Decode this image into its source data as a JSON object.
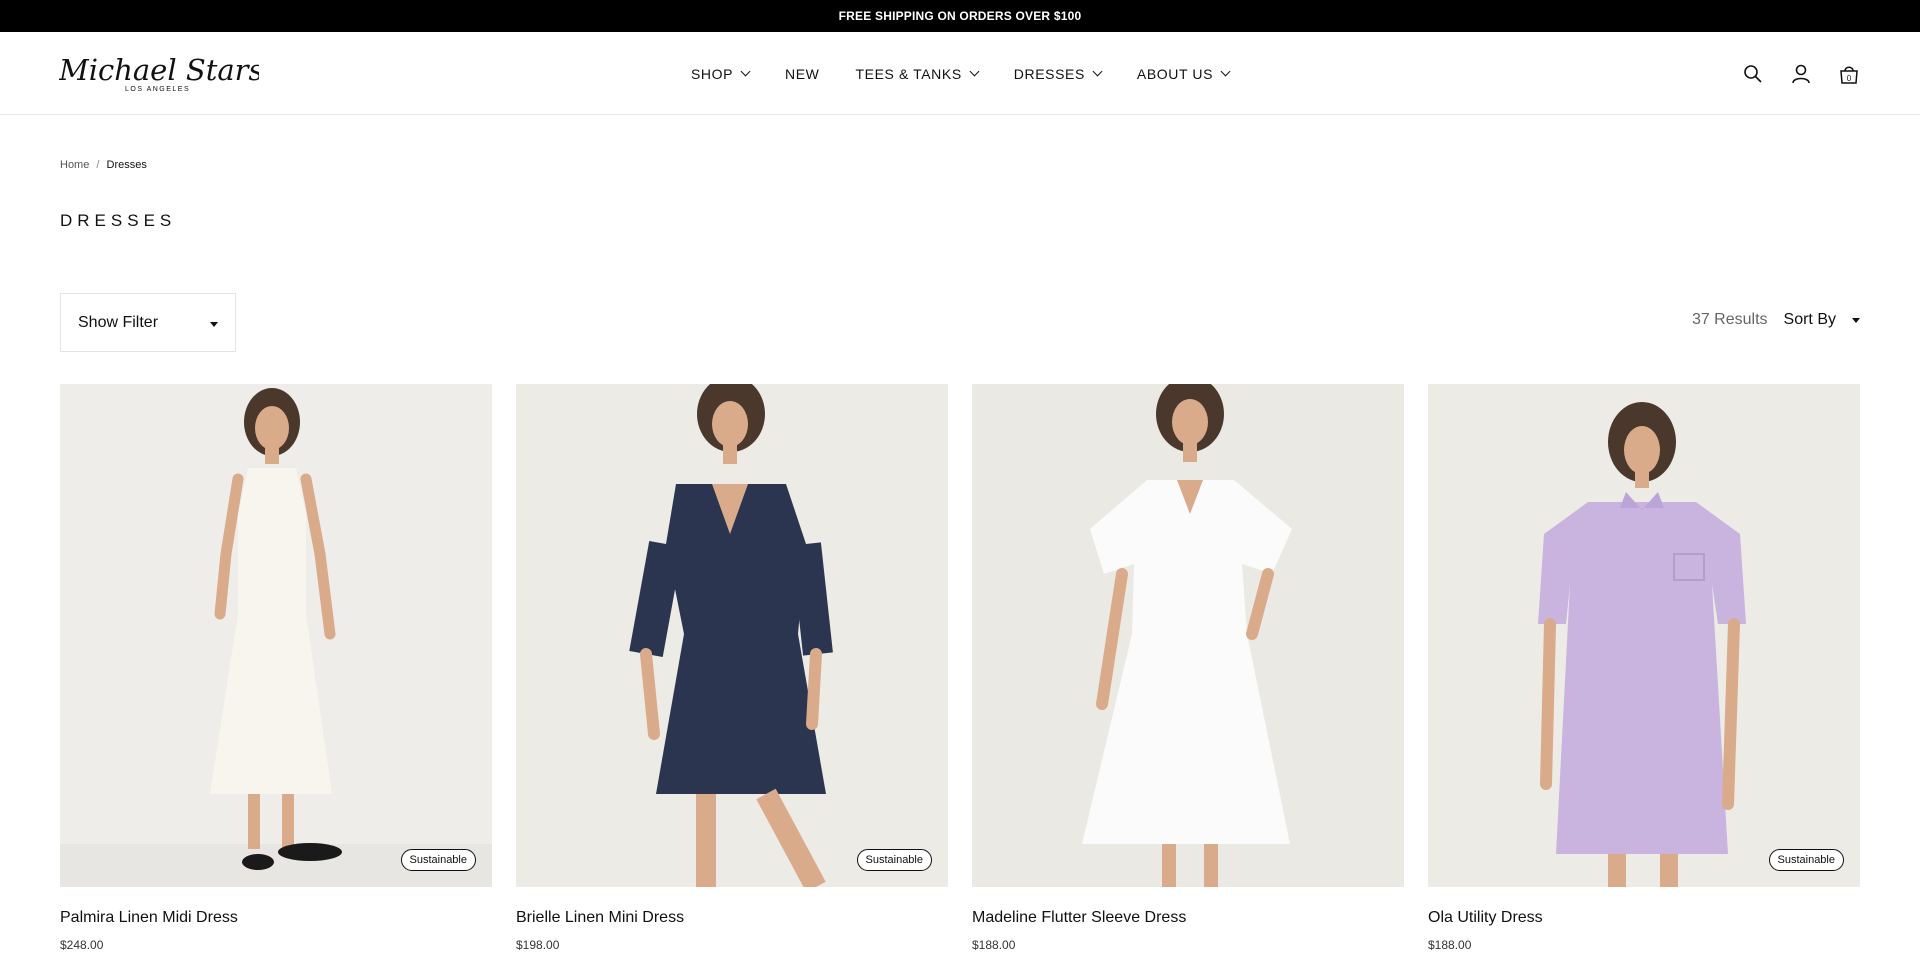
{
  "promo": {
    "text": "FREE SHIPPING ON ORDERS OVER $100"
  },
  "brand": {
    "name": "Michael Stars",
    "city": "LOS ANGELES"
  },
  "nav": {
    "shop": "SHOP",
    "new": "NEW",
    "tees": "TEES & TANKS",
    "dresses": "DRESSES",
    "about": "ABOUT US"
  },
  "header_icons": {
    "search": "search-icon",
    "account": "user-icon",
    "cart": "bag-icon",
    "cart_count": "0"
  },
  "breadcrumb": {
    "home": "Home",
    "separator": "/",
    "current": "Dresses"
  },
  "page": {
    "title": "DRESSES"
  },
  "filter": {
    "label": "Show Filter"
  },
  "results": {
    "count": "37 Results",
    "sort_label": "Sort By"
  },
  "products": [
    {
      "name": "Palmira Linen Midi Dress",
      "price": "$248.00",
      "badge": "Sustainable",
      "dress_color": "#f7f5ee",
      "bg": "#eeede9"
    },
    {
      "name": "Brielle Linen Mini Dress",
      "price": "$198.00",
      "badge": "Sustainable",
      "dress_color": "#2b3550",
      "bg": "#ecebe6"
    },
    {
      "name": "Madeline Flutter Sleeve Dress",
      "price": "$188.00",
      "badge": "",
      "dress_color": "#fbfbfb",
      "bg": "#ebe9e3"
    },
    {
      "name": "Ola Utility Dress",
      "price": "$188.00",
      "badge": "Sustainable",
      "dress_color": "#c9b4e0",
      "bg": "#ecebe6"
    }
  ]
}
